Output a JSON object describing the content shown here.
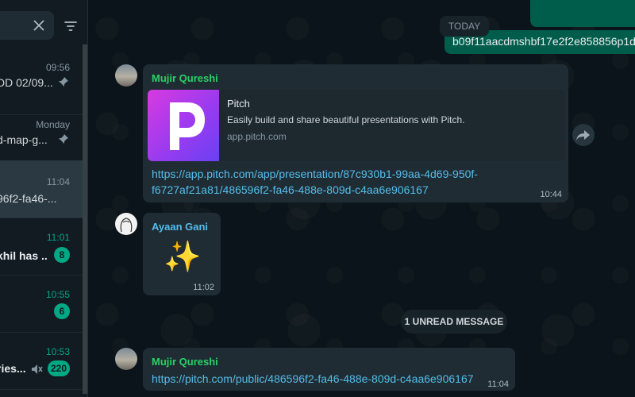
{
  "sidebar": {
    "chats": [
      {
        "time": "09:56",
        "preview": "DD 02/09...",
        "pinned": true
      },
      {
        "time": "Monday",
        "preview": "d-map-g...",
        "pinned": true
      },
      {
        "time": "11:04",
        "preview": "96f2-fa46-...",
        "active": true
      },
      {
        "time": "11:01",
        "preview": "khil has ...",
        "unread_count": "8"
      },
      {
        "time": "10:55",
        "preview": "",
        "unread_count": "6"
      },
      {
        "time": "10:53",
        "preview": "ries...",
        "unread_count": "220",
        "muted": true
      }
    ]
  },
  "conversation": {
    "outgoing_partial_text": "b09f11aacdmshbf17e2f2e858856p1d",
    "day_divider": "TODAY",
    "messages": [
      {
        "sender": "Mujir Qureshi",
        "preview_title": "Pitch",
        "preview_description": "Easily build and share beautiful presentations with Pitch.",
        "preview_domain": "app.pitch.com",
        "link_line1": "https://app.pitch.com/app/presentation/87c930b1-99aa-4d69-950f-",
        "link_line2": "f6727af21a81/486596f2-fa46-488e-809d-c4aa6e906167",
        "time": "10:44"
      },
      {
        "sender": "Ayaan Gani",
        "emoji": "✨",
        "time": "11:02"
      },
      {
        "sender": "Mujir Qureshi",
        "link": "https://pitch.com/public/486596f2-fa46-488e-809d-c4aa6e906167",
        "time": "11:04"
      }
    ],
    "unread_divider": "1 UNREAD MESSAGE"
  },
  "colors": {
    "accent": "#00a884",
    "outgoing_bubble": "#005c4b",
    "incoming_bubble": "#202c33",
    "link": "#53bdeb"
  }
}
